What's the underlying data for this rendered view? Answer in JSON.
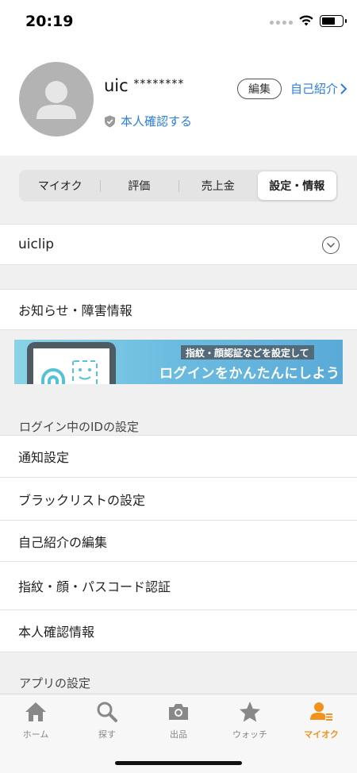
{
  "status_bar": {
    "time": "20:19"
  },
  "profile": {
    "name": "uic",
    "name_mask": "********",
    "verify_label": "本人確認する",
    "edit_label": "編集",
    "intro_label": "自己紹介"
  },
  "tabs": [
    {
      "label": "マイオク",
      "active": false
    },
    {
      "label": "評価",
      "active": false
    },
    {
      "label": "売上金",
      "active": false
    },
    {
      "label": "設定・情報",
      "active": true
    }
  ],
  "account": {
    "id": "uiclip"
  },
  "notice": {
    "label": "お知らせ・障害情報"
  },
  "banner": {
    "subtitle": "指紋・顔認証などを設定して",
    "title": "ログインをかんたんにしよう"
  },
  "login_settings": {
    "header": "ログイン中のIDの設定",
    "items": [
      "通知設定",
      "ブラックリストの設定",
      "自己紹介の編集",
      "指紋・顔・パスコード認証",
      "本人確認情報"
    ]
  },
  "app_settings": {
    "header": "アプリの設定"
  },
  "tabbar": {
    "items": [
      {
        "label": "ホーム",
        "icon": "home-icon",
        "active": false
      },
      {
        "label": "探す",
        "icon": "search-icon",
        "active": false
      },
      {
        "label": "出品",
        "icon": "camera-icon",
        "active": false
      },
      {
        "label": "ウォッチ",
        "icon": "star-icon",
        "active": false
      },
      {
        "label": "マイオク",
        "icon": "person-list-icon",
        "active": true
      }
    ]
  },
  "colors": {
    "link": "#2b7de1",
    "accent": "#f0921e",
    "inactive": "#888888"
  }
}
